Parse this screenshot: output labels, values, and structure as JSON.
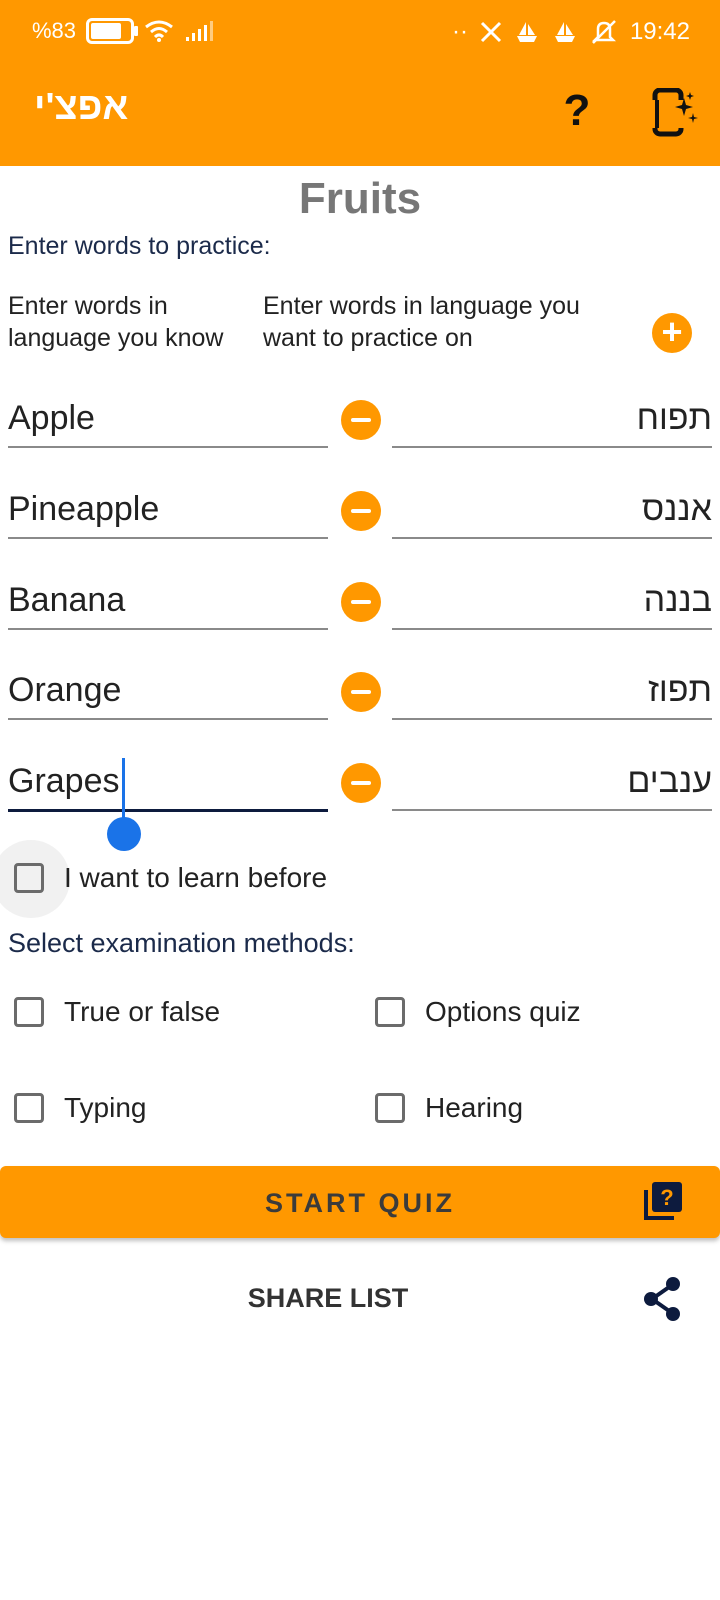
{
  "status_bar": {
    "battery_percent": "%83",
    "time": "19:42",
    "dots": "··"
  },
  "app_bar": {
    "title": "אפצ'י",
    "help_label": "?"
  },
  "screen": {
    "title": "Fruits",
    "enter_label": "Enter words to practice:"
  },
  "columns": {
    "known_hint": "Enter words in language you know",
    "practice_hint": "Enter words in language you want to practice on",
    "add_label": "+"
  },
  "words": [
    {
      "known": "Apple",
      "practice": "תפוח"
    },
    {
      "known": "Pineapple",
      "practice": "אננס"
    },
    {
      "known": "Banana",
      "practice": "בננה"
    },
    {
      "known": "Orange",
      "practice": "תפוז"
    },
    {
      "known": "Grapes",
      "practice": "ענבים"
    }
  ],
  "learn_before": {
    "label": "I want to learn before",
    "checked": false
  },
  "methods": {
    "label": "Select examination methods:",
    "true_false": "True or false",
    "options_quiz": "Options quiz",
    "typing": "Typing",
    "hearing": "Hearing"
  },
  "actions": {
    "start_quiz": "START QUIZ",
    "share_list": "SHARE LIST"
  },
  "colors": {
    "accent": "#FF9800",
    "navy": "#0d1b3e",
    "cursor": "#1a73e8"
  }
}
